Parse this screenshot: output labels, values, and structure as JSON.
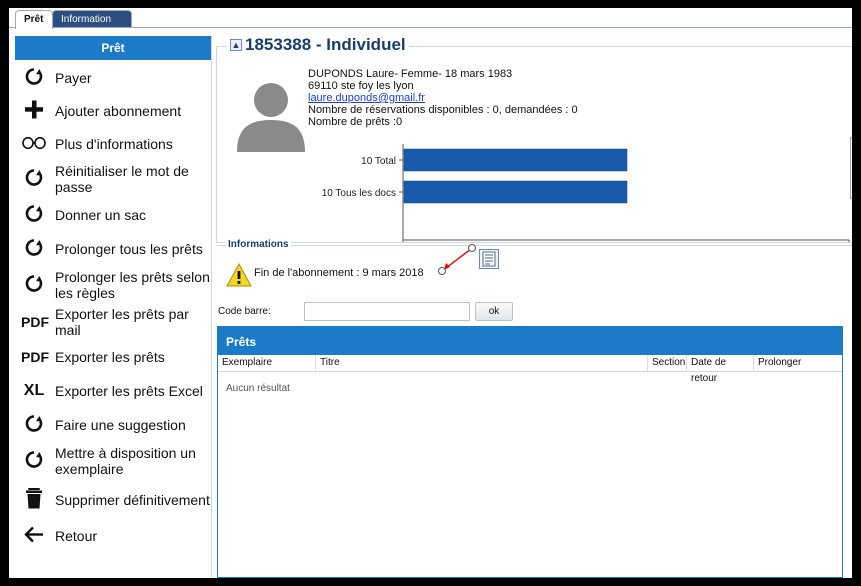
{
  "tabs": [
    {
      "label": "Prêt"
    },
    {
      "label": "Information"
    }
  ],
  "sidebar": {
    "title": "Prêt",
    "items": [
      {
        "label": "Payer",
        "icon": "refresh-icon"
      },
      {
        "label": "Ajouter abonnement",
        "icon": "plus-icon"
      },
      {
        "label": "Plus d'informations",
        "icon": "glasses-icon"
      },
      {
        "label": "Réinitialiser le mot de passe",
        "icon": "refresh-icon"
      },
      {
        "label": "Donner un sac",
        "icon": "refresh-icon"
      },
      {
        "label": "Prolonger tous les prêts",
        "icon": "refresh-icon"
      },
      {
        "label": "Prolonger les prêts selon les règles",
        "icon": "refresh-icon"
      },
      {
        "label": "Exporter les prêts par mail",
        "icon": "pdf-icon",
        "icon_text": "PDF"
      },
      {
        "label": "Exporter les prêts",
        "icon": "pdf-icon",
        "icon_text": "PDF"
      },
      {
        "label": "Exporter les prêts Excel",
        "icon": "excel-icon",
        "icon_text": "XL"
      },
      {
        "label": "Faire une suggestion",
        "icon": "refresh-icon"
      },
      {
        "label": "Mettre à disposition un exemplaire",
        "icon": "refresh-icon"
      },
      {
        "label": "Supprimer définitivement",
        "icon": "trash-icon"
      },
      {
        "label": "Retour",
        "icon": "arrow-left-icon"
      }
    ]
  },
  "profile": {
    "collapse_symbol": "▲",
    "title": "1853388 - Individuel",
    "line1": "DUPONDS Laure- Femme- 18 mars 1983",
    "line2": "69110 ste foy les lyon",
    "email": "laure.duponds@gmail.fr",
    "line4": "Nombre de réservations disponibles : 0, demandées : 0",
    "line5": "Nombre de prêts :0"
  },
  "chart_data": {
    "type": "bar",
    "orientation": "horizontal",
    "categories": [
      "10 Total",
      "10 Tous les docs"
    ],
    "values": [
      10,
      10
    ],
    "xlim": [
      0,
      20
    ],
    "xticks": [
      "0",
      "20"
    ],
    "color": "#1a5cab"
  },
  "infos": {
    "legend": "Informations",
    "text": "Fin de l'abonnement : 9 mars 2018"
  },
  "barcode": {
    "label": "Code barre:",
    "value": "",
    "ok_label": "ok"
  },
  "loans": {
    "title": "Prêts",
    "columns": [
      "Exemplaire",
      "Titre",
      "Section",
      "Date de retour",
      "Prolonger"
    ],
    "empty_text": "Aucun résultat"
  },
  "colors": {
    "accent": "#1b7bc8",
    "title": "#1a3d6e",
    "bar": "#1a5cab"
  }
}
